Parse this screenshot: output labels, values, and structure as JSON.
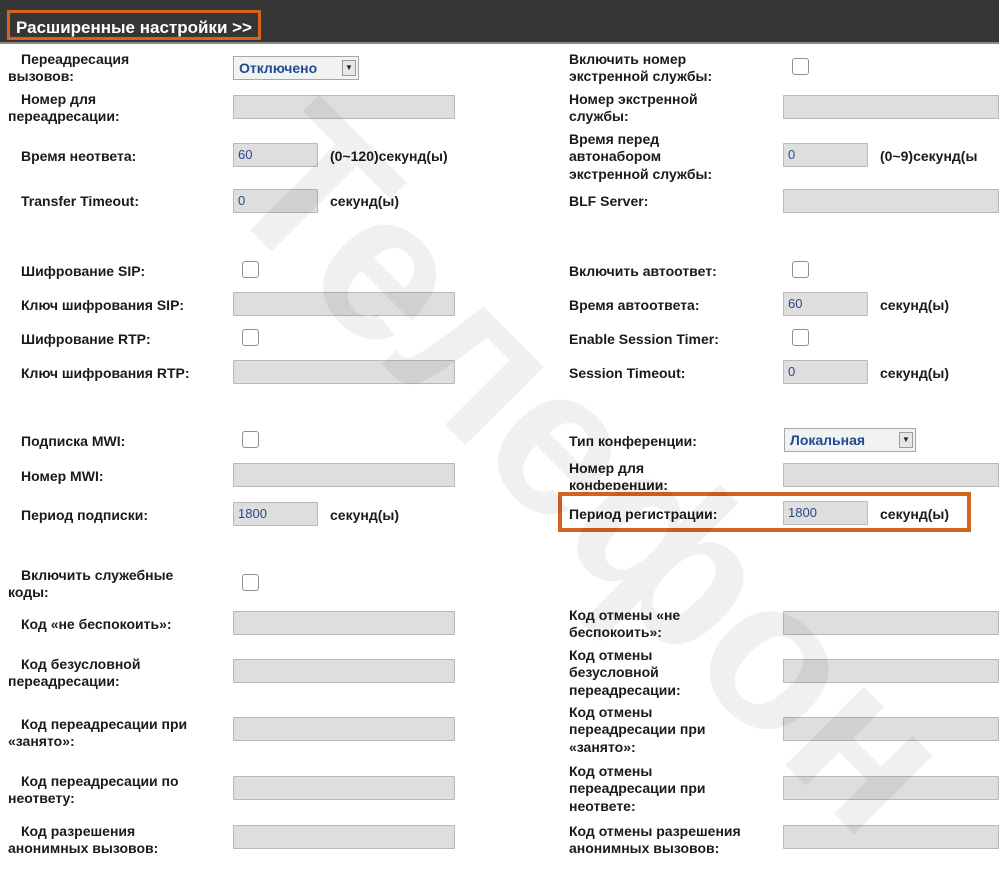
{
  "header": {
    "title": "Расширенные настройки >>"
  },
  "left": {
    "forward": {
      "l1": "Переадресация",
      "l2": "вызовов:",
      "value": "Отключено"
    },
    "forward_number": {
      "l1": "Номер для",
      "l2": "переадресации:",
      "value": ""
    },
    "no_answer": {
      "label": "Время неответа:",
      "value": "60",
      "unit": "(0~120)секунд(ы)"
    },
    "transfer_timeout": {
      "label": "Transfer Timeout:",
      "value": "0",
      "unit": "секунд(ы)"
    },
    "sip_encryption": {
      "label": "Шифрование SIP:"
    },
    "sip_key": {
      "label": "Ключ шифрования SIP:",
      "value": ""
    },
    "rtp_encryption": {
      "label": "Шифрование RTP:"
    },
    "rtp_key": {
      "label": "Ключ шифрования RTP:",
      "value": ""
    },
    "mwi_subscribe": {
      "label": "Подписка MWI:"
    },
    "mwi_number": {
      "label": "Номер MWI:",
      "value": ""
    },
    "subscribe_period": {
      "label": "Период подписки:",
      "value": "1800",
      "unit": "секунд(ы)"
    },
    "service_codes": {
      "l1": "Включить служебные",
      "l2": "коды:"
    },
    "dnd_code": {
      "label": "Код «не беспокоить»:",
      "value": ""
    },
    "uncond_code": {
      "l1": "Код безусловной",
      "l2": "переадресации:",
      "value": ""
    },
    "busy_code": {
      "l1": "Код переадресации при",
      "l2": "«занято»:",
      "value": ""
    },
    "noans_code": {
      "l1": "Код переадресации по",
      "l2": "неответу:",
      "value": ""
    },
    "anon_code": {
      "l1": "Код разрешения",
      "l2": "анонимных вызовов:",
      "value": ""
    }
  },
  "right": {
    "emergency_enable": {
      "l1": "Включить номер",
      "l2": "экстренной службы:"
    },
    "emergency_number": {
      "l1": "Номер экстренной",
      "l2": "службы:",
      "value": ""
    },
    "emergency_delay": {
      "l1": "Время перед",
      "l2": "автонабором",
      "l3": "экстренной службы:",
      "value": "0",
      "unit": "(0~9)секунд(ы"
    },
    "blf_server": {
      "label": "BLF Server:",
      "value": ""
    },
    "auto_answer": {
      "label": "Включить автоответ:"
    },
    "auto_answer_time": {
      "label": "Время автоответа:",
      "value": "60",
      "unit": "секунд(ы)"
    },
    "session_timer": {
      "label": "Enable Session Timer:"
    },
    "session_timeout": {
      "label": "Session Timeout:",
      "value": "0",
      "unit": "секунд(ы)"
    },
    "conference_type": {
      "label": "Тип конференции:",
      "value": "Локальная"
    },
    "conference_number": {
      "l1": "Номер для",
      "l2": "конференции:",
      "value": ""
    },
    "register_period": {
      "label": "Период регистрации:",
      "value": "1800",
      "unit": "секунд(ы)"
    },
    "dnd_cancel": {
      "l1": "Код отмены «не",
      "l2": "беспокоить»:",
      "value": ""
    },
    "uncond_cancel": {
      "l1": "Код отмены",
      "l2": "безусловной",
      "l3": "переадресации:",
      "value": ""
    },
    "busy_cancel": {
      "l1": "Код отмены",
      "l2": "переадресации при",
      "l3": "«занято»:",
      "value": ""
    },
    "noans_cancel": {
      "l1": "Код отмены",
      "l2": "переадресации при",
      "l3": "неответе:",
      "value": ""
    },
    "anon_cancel": {
      "l1": "Код отмены разрешения",
      "l2": "анонимных вызовов:",
      "value": ""
    }
  },
  "watermark": {
    "text": "Телефон"
  },
  "colors": {
    "accent": "#d4631f",
    "header_bg": "#363636",
    "field_bg": "#dedede",
    "value_text": "#2a4a8a"
  }
}
